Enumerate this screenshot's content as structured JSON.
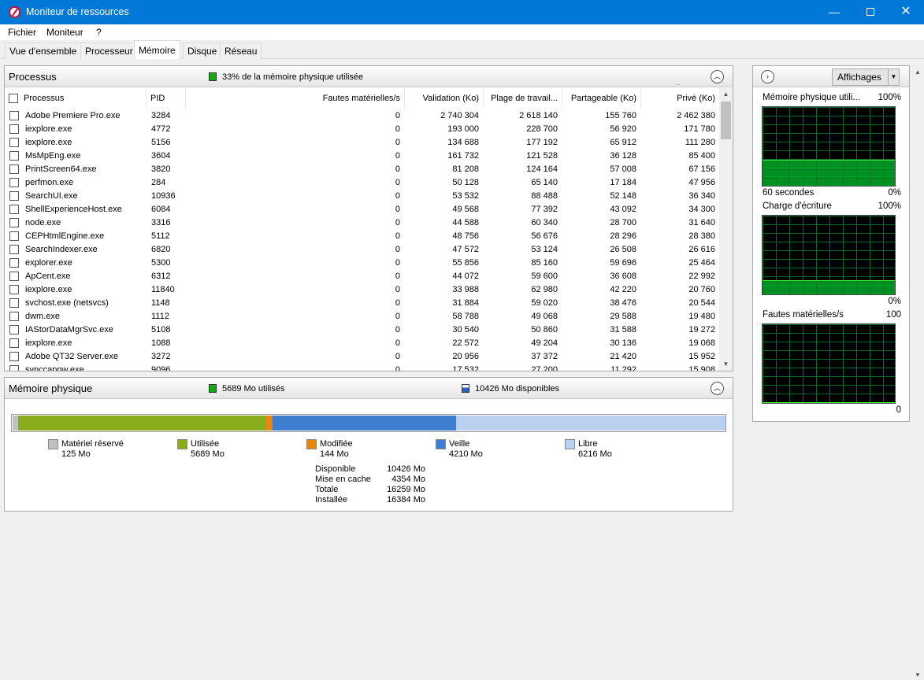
{
  "window": {
    "title": "Moniteur de ressources"
  },
  "menu": [
    "Fichier",
    "Moniteur",
    "?"
  ],
  "tabs": [
    "Vue d'ensemble",
    "Processeur",
    "Mémoire",
    "Disque",
    "Réseau"
  ],
  "active_tab": "Mémoire",
  "processes": {
    "title": "Processus",
    "summary": "33% de la mémoire physique utilisée",
    "columns": [
      "Processus",
      "PID",
      "Fautes matérielles/s",
      "Validation (Ko)",
      "Plage de travail...",
      "Partageable (Ko)",
      "Privé (Ko)"
    ],
    "sorted_column": "Privé (Ko)",
    "rows": [
      {
        "name": "Adobe Premiere Pro.exe",
        "pid": "3284",
        "faults": "0",
        "commit": "2 740 304",
        "working": "2 618 140",
        "shareable": "155 760",
        "private": "2 462 380"
      },
      {
        "name": "iexplore.exe",
        "pid": "4772",
        "faults": "0",
        "commit": "193 000",
        "working": "228 700",
        "shareable": "56 920",
        "private": "171 780"
      },
      {
        "name": "iexplore.exe",
        "pid": "5156",
        "faults": "0",
        "commit": "134 688",
        "working": "177 192",
        "shareable": "65 912",
        "private": "111 280"
      },
      {
        "name": "MsMpEng.exe",
        "pid": "3604",
        "faults": "0",
        "commit": "161 732",
        "working": "121 528",
        "shareable": "36 128",
        "private": "85 400"
      },
      {
        "name": "PrintScreen64.exe",
        "pid": "3820",
        "faults": "0",
        "commit": "81 208",
        "working": "124 164",
        "shareable": "57 008",
        "private": "67 156"
      },
      {
        "name": "perfmon.exe",
        "pid": "284",
        "faults": "0",
        "commit": "50 128",
        "working": "65 140",
        "shareable": "17 184",
        "private": "47 956"
      },
      {
        "name": "SearchUI.exe",
        "pid": "10936",
        "faults": "0",
        "commit": "53 532",
        "working": "88 488",
        "shareable": "52 148",
        "private": "36 340"
      },
      {
        "name": "ShellExperienceHost.exe",
        "pid": "6084",
        "faults": "0",
        "commit": "49 568",
        "working": "77 392",
        "shareable": "43 092",
        "private": "34 300"
      },
      {
        "name": "node.exe",
        "pid": "3316",
        "faults": "0",
        "commit": "44 588",
        "working": "60 340",
        "shareable": "28 700",
        "private": "31 640"
      },
      {
        "name": "CEPHtmlEngine.exe",
        "pid": "5112",
        "faults": "0",
        "commit": "48 756",
        "working": "56 676",
        "shareable": "28 296",
        "private": "28 380"
      },
      {
        "name": "SearchIndexer.exe",
        "pid": "6820",
        "faults": "0",
        "commit": "47 572",
        "working": "53 124",
        "shareable": "26 508",
        "private": "26 616"
      },
      {
        "name": "explorer.exe",
        "pid": "5300",
        "faults": "0",
        "commit": "55 856",
        "working": "85 160",
        "shareable": "59 696",
        "private": "25 464"
      },
      {
        "name": "ApCent.exe",
        "pid": "6312",
        "faults": "0",
        "commit": "44 072",
        "working": "59 600",
        "shareable": "36 608",
        "private": "22 992"
      },
      {
        "name": "iexplore.exe",
        "pid": "11840",
        "faults": "0",
        "commit": "33 988",
        "working": "62 980",
        "shareable": "42 220",
        "private": "20 760"
      },
      {
        "name": "svchost.exe (netsvcs)",
        "pid": "1148",
        "faults": "0",
        "commit": "31 884",
        "working": "59 020",
        "shareable": "38 476",
        "private": "20 544"
      },
      {
        "name": "dwm.exe",
        "pid": "1112",
        "faults": "0",
        "commit": "58 788",
        "working": "49 068",
        "shareable": "29 588",
        "private": "19 480"
      },
      {
        "name": "IAStorDataMgrSvc.exe",
        "pid": "5108",
        "faults": "0",
        "commit": "30 540",
        "working": "50 860",
        "shareable": "31 588",
        "private": "19 272"
      },
      {
        "name": "iexplore.exe",
        "pid": "1088",
        "faults": "0",
        "commit": "22 572",
        "working": "49 204",
        "shareable": "30 136",
        "private": "19 068"
      },
      {
        "name": "Adobe QT32 Server.exe",
        "pid": "3272",
        "faults": "0",
        "commit": "20 956",
        "working": "37 372",
        "shareable": "21 420",
        "private": "15 952"
      },
      {
        "name": "synccapnw.exe",
        "pid": "9096",
        "faults": "0",
        "commit": "17 532",
        "working": "27 200",
        "shareable": "11 292",
        "private": "15 908"
      }
    ]
  },
  "physical_memory": {
    "title": "Mémoire physique",
    "used_label": "5689 Mo utilisés",
    "available_label": "10426 Mo disponibles",
    "segments": [
      {
        "key": "reserved",
        "label": "Matériel réservé",
        "value": "125 Mo",
        "mb": 125,
        "color": "#c0c0c0"
      },
      {
        "key": "used",
        "label": "Utilisée",
        "value": "5689 Mo",
        "mb": 5689,
        "color": "#8aad1e"
      },
      {
        "key": "modified",
        "label": "Modifiée",
        "value": "144 Mo",
        "mb": 144,
        "color": "#e8870f"
      },
      {
        "key": "standby",
        "label": "Veille",
        "value": "4210 Mo",
        "mb": 4210,
        "color": "#3f7fcf"
      },
      {
        "key": "free",
        "label": "Libre",
        "value": "6216 Mo",
        "mb": 6216,
        "color": "#b9d1ee"
      }
    ],
    "stats": [
      {
        "label": "Disponible",
        "value": "10426 Mo"
      },
      {
        "label": "Mise en cache",
        "value": "4354 Mo"
      },
      {
        "label": "Totale",
        "value": "16259 Mo"
      },
      {
        "label": "Installée",
        "value": "16384 Mo"
      }
    ]
  },
  "graphs": {
    "views_button": "Affichages",
    "items": [
      {
        "title": "Mémoire physique utili...",
        "max": "100%",
        "footer_left": "60 secondes",
        "footer_right": "0%",
        "level": 0.33
      },
      {
        "title": "Charge d'écriture",
        "max": "100%",
        "footer_left": "",
        "footer_right": "0%",
        "level": 0.18
      },
      {
        "title": "Fautes matérielles/s",
        "max": "100",
        "footer_left": "",
        "footer_right": "0",
        "level": 0.0
      }
    ]
  },
  "colors": {
    "titlebar": "#0078d7",
    "graph_line": "#33ff33",
    "graph_grid": "#0b6b2e"
  }
}
